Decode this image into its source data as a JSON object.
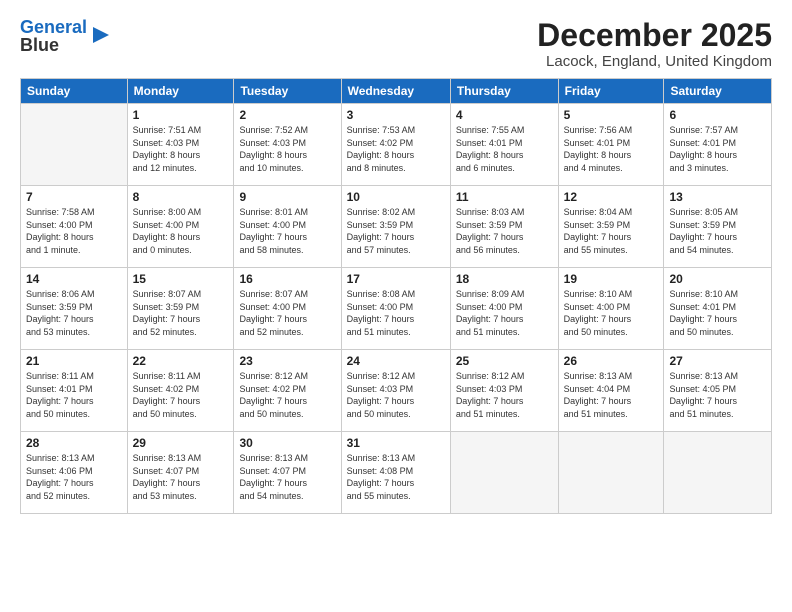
{
  "header": {
    "logo_line1": "General",
    "logo_line2": "Blue",
    "month": "December 2025",
    "location": "Lacock, England, United Kingdom"
  },
  "weekdays": [
    "Sunday",
    "Monday",
    "Tuesday",
    "Wednesday",
    "Thursday",
    "Friday",
    "Saturday"
  ],
  "weeks": [
    [
      {
        "day": "",
        "info": ""
      },
      {
        "day": "1",
        "info": "Sunrise: 7:51 AM\nSunset: 4:03 PM\nDaylight: 8 hours\nand 12 minutes."
      },
      {
        "day": "2",
        "info": "Sunrise: 7:52 AM\nSunset: 4:03 PM\nDaylight: 8 hours\nand 10 minutes."
      },
      {
        "day": "3",
        "info": "Sunrise: 7:53 AM\nSunset: 4:02 PM\nDaylight: 8 hours\nand 8 minutes."
      },
      {
        "day": "4",
        "info": "Sunrise: 7:55 AM\nSunset: 4:01 PM\nDaylight: 8 hours\nand 6 minutes."
      },
      {
        "day": "5",
        "info": "Sunrise: 7:56 AM\nSunset: 4:01 PM\nDaylight: 8 hours\nand 4 minutes."
      },
      {
        "day": "6",
        "info": "Sunrise: 7:57 AM\nSunset: 4:01 PM\nDaylight: 8 hours\nand 3 minutes."
      }
    ],
    [
      {
        "day": "7",
        "info": "Sunrise: 7:58 AM\nSunset: 4:00 PM\nDaylight: 8 hours\nand 1 minute."
      },
      {
        "day": "8",
        "info": "Sunrise: 8:00 AM\nSunset: 4:00 PM\nDaylight: 8 hours\nand 0 minutes."
      },
      {
        "day": "9",
        "info": "Sunrise: 8:01 AM\nSunset: 4:00 PM\nDaylight: 7 hours\nand 58 minutes."
      },
      {
        "day": "10",
        "info": "Sunrise: 8:02 AM\nSunset: 3:59 PM\nDaylight: 7 hours\nand 57 minutes."
      },
      {
        "day": "11",
        "info": "Sunrise: 8:03 AM\nSunset: 3:59 PM\nDaylight: 7 hours\nand 56 minutes."
      },
      {
        "day": "12",
        "info": "Sunrise: 8:04 AM\nSunset: 3:59 PM\nDaylight: 7 hours\nand 55 minutes."
      },
      {
        "day": "13",
        "info": "Sunrise: 8:05 AM\nSunset: 3:59 PM\nDaylight: 7 hours\nand 54 minutes."
      }
    ],
    [
      {
        "day": "14",
        "info": "Sunrise: 8:06 AM\nSunset: 3:59 PM\nDaylight: 7 hours\nand 53 minutes."
      },
      {
        "day": "15",
        "info": "Sunrise: 8:07 AM\nSunset: 3:59 PM\nDaylight: 7 hours\nand 52 minutes."
      },
      {
        "day": "16",
        "info": "Sunrise: 8:07 AM\nSunset: 4:00 PM\nDaylight: 7 hours\nand 52 minutes."
      },
      {
        "day": "17",
        "info": "Sunrise: 8:08 AM\nSunset: 4:00 PM\nDaylight: 7 hours\nand 51 minutes."
      },
      {
        "day": "18",
        "info": "Sunrise: 8:09 AM\nSunset: 4:00 PM\nDaylight: 7 hours\nand 51 minutes."
      },
      {
        "day": "19",
        "info": "Sunrise: 8:10 AM\nSunset: 4:00 PM\nDaylight: 7 hours\nand 50 minutes."
      },
      {
        "day": "20",
        "info": "Sunrise: 8:10 AM\nSunset: 4:01 PM\nDaylight: 7 hours\nand 50 minutes."
      }
    ],
    [
      {
        "day": "21",
        "info": "Sunrise: 8:11 AM\nSunset: 4:01 PM\nDaylight: 7 hours\nand 50 minutes."
      },
      {
        "day": "22",
        "info": "Sunrise: 8:11 AM\nSunset: 4:02 PM\nDaylight: 7 hours\nand 50 minutes."
      },
      {
        "day": "23",
        "info": "Sunrise: 8:12 AM\nSunset: 4:02 PM\nDaylight: 7 hours\nand 50 minutes."
      },
      {
        "day": "24",
        "info": "Sunrise: 8:12 AM\nSunset: 4:03 PM\nDaylight: 7 hours\nand 50 minutes."
      },
      {
        "day": "25",
        "info": "Sunrise: 8:12 AM\nSunset: 4:03 PM\nDaylight: 7 hours\nand 51 minutes."
      },
      {
        "day": "26",
        "info": "Sunrise: 8:13 AM\nSunset: 4:04 PM\nDaylight: 7 hours\nand 51 minutes."
      },
      {
        "day": "27",
        "info": "Sunrise: 8:13 AM\nSunset: 4:05 PM\nDaylight: 7 hours\nand 51 minutes."
      }
    ],
    [
      {
        "day": "28",
        "info": "Sunrise: 8:13 AM\nSunset: 4:06 PM\nDaylight: 7 hours\nand 52 minutes."
      },
      {
        "day": "29",
        "info": "Sunrise: 8:13 AM\nSunset: 4:07 PM\nDaylight: 7 hours\nand 53 minutes."
      },
      {
        "day": "30",
        "info": "Sunrise: 8:13 AM\nSunset: 4:07 PM\nDaylight: 7 hours\nand 54 minutes."
      },
      {
        "day": "31",
        "info": "Sunrise: 8:13 AM\nSunset: 4:08 PM\nDaylight: 7 hours\nand 55 minutes."
      },
      {
        "day": "",
        "info": ""
      },
      {
        "day": "",
        "info": ""
      },
      {
        "day": "",
        "info": ""
      }
    ]
  ]
}
